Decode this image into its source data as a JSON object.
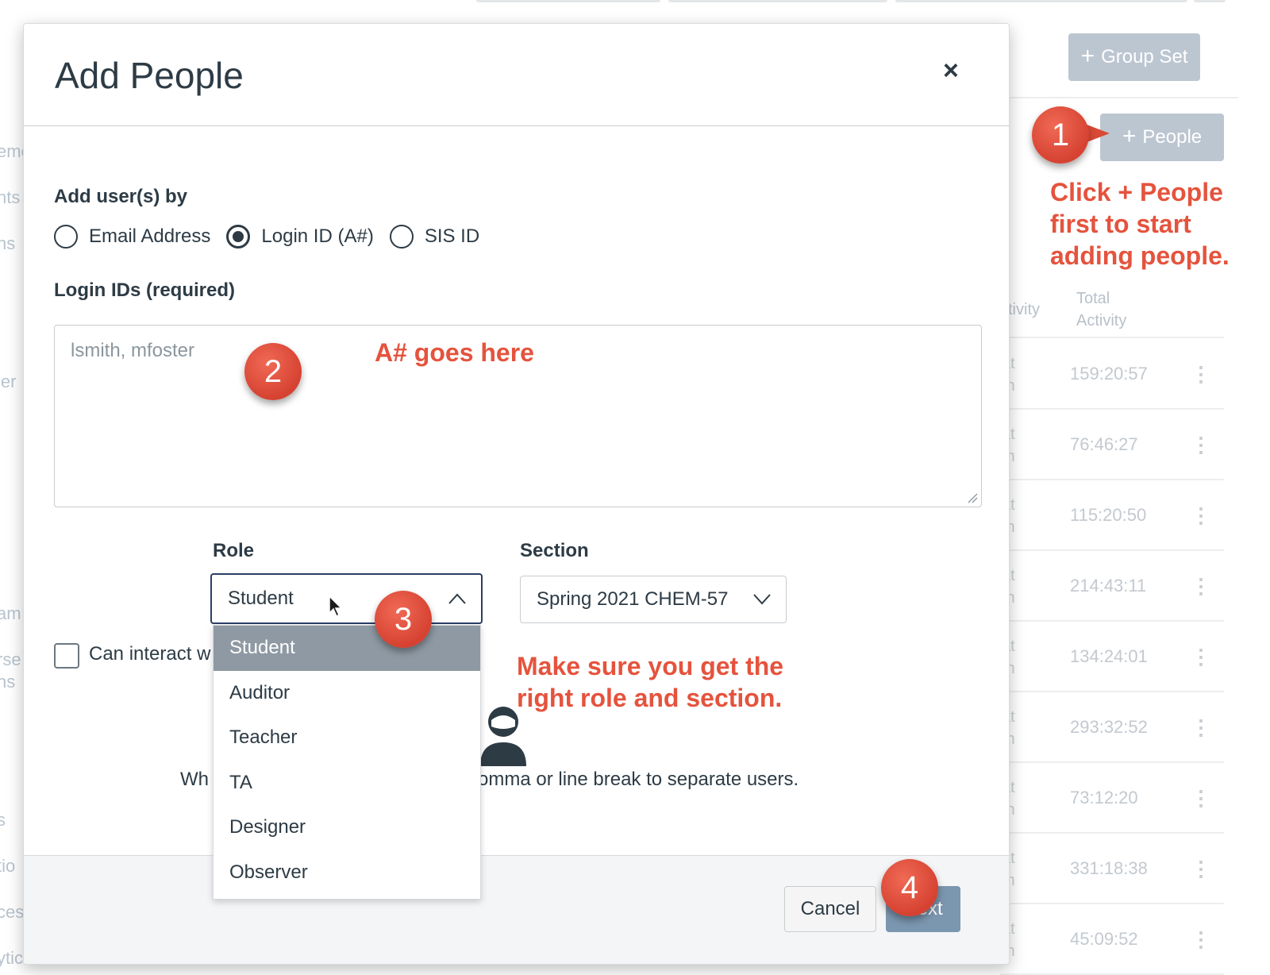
{
  "background": {
    "sidebar_fragments": [
      "eme",
      "nts",
      "ns",
      "ler",
      "am",
      "rse",
      "ns",
      "s",
      "tio",
      "ces",
      "ytics"
    ],
    "group_set_button": {
      "label": "Group Set"
    },
    "people_button": {
      "label": "People"
    },
    "table": {
      "column_partial": "ctivity",
      "column_total": [
        "Total",
        "Activity"
      ],
      "row_fragment_top": "at",
      "row_fragment_bottom": "m",
      "rows": [
        "159:20:57",
        "76:46:27",
        "115:20:50",
        "214:43:11",
        "134:24:01",
        "293:32:52",
        "73:12:20",
        "331:18:38",
        "45:09:52"
      ]
    }
  },
  "dialog": {
    "title": "Add People",
    "close_label": "×",
    "add_by_label": "Add user(s) by",
    "add_by_options": [
      "Email Address",
      "Login ID (A#)",
      "SIS ID"
    ],
    "add_by_selected": "Login ID (A#)",
    "login_ids_label": "Login IDs (required)",
    "login_ids_placeholder": "lsmith, mfoster",
    "role_label": "Role",
    "role_value": "Student",
    "role_options": [
      "Student",
      "Auditor",
      "Teacher",
      "TA",
      "Designer",
      "Observer"
    ],
    "section_label": "Section",
    "section_value": "Spring 2021 CHEM-57",
    "checkbox_label": "Can interact w",
    "hint_prefix": "Wh",
    "hint_suffix": "comma or line break to separate users.",
    "cancel_label": "Cancel",
    "next_label": "Next"
  },
  "annotations": {
    "steps": [
      "1",
      "2",
      "3",
      "4"
    ],
    "step1_text": [
      "Click + People",
      "first to start",
      "adding people."
    ],
    "step2_text": "A# goes here",
    "step3_text": [
      "Make sure you get the",
      "right role and section."
    ]
  },
  "colors": {
    "annotation_red": "#e5533d",
    "dialog_text": "#2d3b45",
    "disabled_button": "#bcc6d1",
    "selected_option": "#8e99a3",
    "next_button": "#6e8ca8"
  }
}
